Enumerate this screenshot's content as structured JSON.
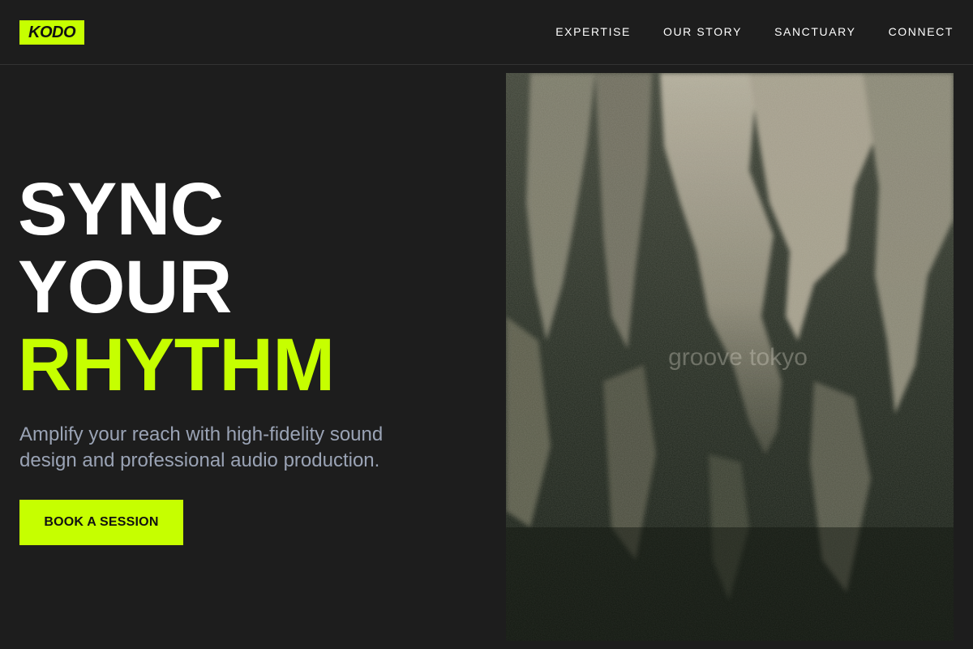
{
  "header": {
    "logo_text": "KODO",
    "nav": [
      {
        "label": "EXPERTISE"
      },
      {
        "label": "OUR STORY"
      },
      {
        "label": "SANCTUARY"
      },
      {
        "label": "CONNECT"
      }
    ]
  },
  "hero": {
    "title_line1": "SYNC",
    "title_line2": "YOUR",
    "title_line3": "RHYTHM",
    "subtitle": "Amplify your reach with high-fidelity sound design and professional audio production.",
    "cta_label": "BOOK A SESSION"
  },
  "image": {
    "watermark": "groove tokyo"
  },
  "colors": {
    "accent": "#c6ff00",
    "background": "#1d1d1d",
    "subtitle": "#9aa3b5"
  }
}
